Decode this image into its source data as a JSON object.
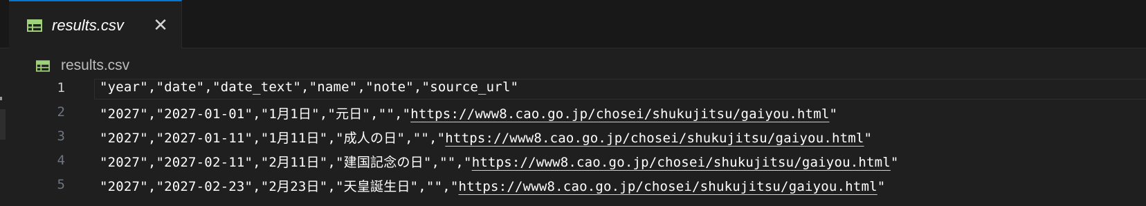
{
  "tab": {
    "icon": "table-grid-icon",
    "label": "results.csv",
    "close_icon": "close-icon",
    "close_glyph": "✕"
  },
  "breadcrumb": {
    "icon": "table-grid-icon",
    "label": "results.csv"
  },
  "colors": {
    "accent": "#0078d4",
    "icon_green": "#9fd07a",
    "background": "#1f1f1f"
  },
  "editor": {
    "lines": [
      {
        "number": "1",
        "text": "\"year\",\"date\",\"date_text\",\"name\",\"note\",\"source_url\"",
        "url": ""
      },
      {
        "number": "2",
        "text": "\"2027\",\"2027-01-01\",\"1月1日\",\"元日\",\"\",\"",
        "url": "https://www8.cao.go.jp/chosei/shukujitsu/gaiyou.html",
        "tail": "\""
      },
      {
        "number": "3",
        "text": "\"2027\",\"2027-01-11\",\"1月11日\",\"成人の日\",\"\",\"",
        "url": "https://www8.cao.go.jp/chosei/shukujitsu/gaiyou.html",
        "tail": "\""
      },
      {
        "number": "4",
        "text": "\"2027\",\"2027-02-11\",\"2月11日\",\"建国記念の日\",\"\",\"",
        "url": "https://www8.cao.go.jp/chosei/shukujitsu/gaiyou.html",
        "tail": "\""
      },
      {
        "number": "5",
        "text": "\"2027\",\"2027-02-23\",\"2月23日\",\"天皇誕生日\",\"\",\"",
        "url": "https://www8.cao.go.jp/chosei/shukujitsu/gaiyou.html",
        "tail": "\""
      }
    ]
  }
}
